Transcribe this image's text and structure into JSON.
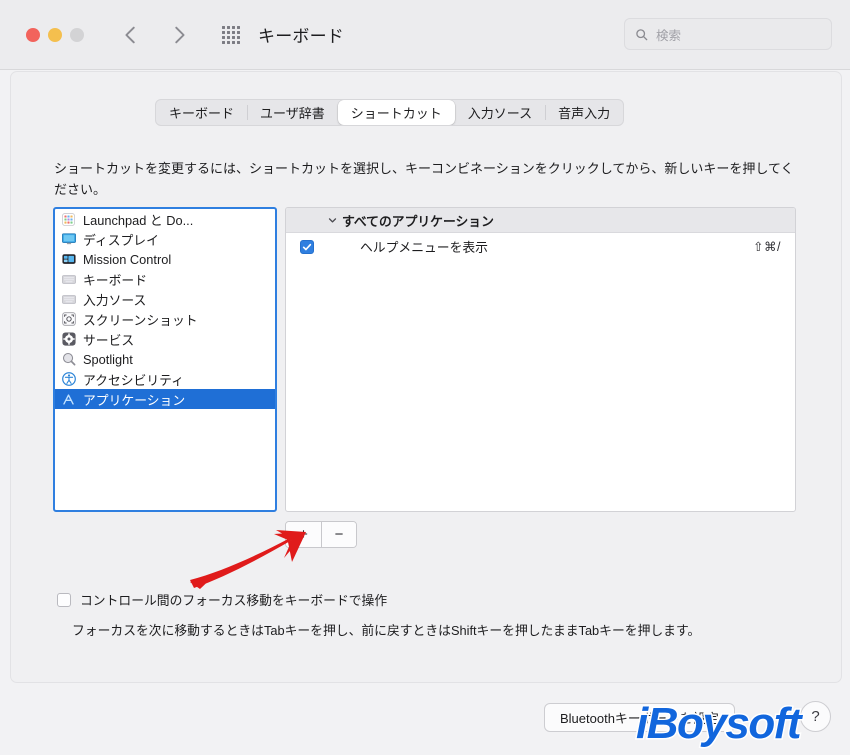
{
  "window": {
    "title": "キーボード",
    "traffic_lights": [
      "close",
      "minimize",
      "zoom"
    ],
    "back_label": "戻る",
    "forward_label": "進む",
    "grid_label": "すべてを表示"
  },
  "search": {
    "placeholder": "検索",
    "value": "",
    "icon": "search-icon"
  },
  "tabs": [
    {
      "label": "キーボード",
      "active": false
    },
    {
      "label": "ユーザ辞書",
      "active": false
    },
    {
      "label": "ショートカット",
      "active": true
    },
    {
      "label": "入力ソース",
      "active": false
    },
    {
      "label": "音声入力",
      "active": false
    }
  ],
  "description": "ショートカットを変更するには、ショートカットを選択し、キーコンビネーションをクリックしてから、新しいキーを押してください。",
  "sidebar": {
    "items": [
      {
        "label": "Launchpad と Do...",
        "icon": "launchpad-icon",
        "selected": false
      },
      {
        "label": "ディスプレイ",
        "icon": "display-icon",
        "selected": false
      },
      {
        "label": "Mission Control",
        "icon": "mission-control-icon",
        "selected": false
      },
      {
        "label": "キーボード",
        "icon": "keyboard-icon",
        "selected": false
      },
      {
        "label": "入力ソース",
        "icon": "input-source-icon",
        "selected": false
      },
      {
        "label": "スクリーンショット",
        "icon": "screenshot-icon",
        "selected": false
      },
      {
        "label": "サービス",
        "icon": "services-icon",
        "selected": false
      },
      {
        "label": "Spotlight",
        "icon": "spotlight-icon",
        "selected": false
      },
      {
        "label": "アクセシビリティ",
        "icon": "accessibility-icon",
        "selected": false
      },
      {
        "label": "アプリケーション",
        "icon": "applications-icon",
        "selected": true
      }
    ]
  },
  "shortcut_list": {
    "group_header": "すべてのアプリケーション",
    "disclosure_icon": "chevron-down-icon",
    "rows": [
      {
        "checked": true,
        "name": "ヘルプメニューを表示",
        "keys": "⇧⌘/"
      }
    ]
  },
  "list_buttons": {
    "add_label": "+",
    "remove_label": "−"
  },
  "annotation": {
    "arrow_color": "#e01b1b",
    "points_to": "add-shortcut-button"
  },
  "focus_option": {
    "checked": false,
    "label": "コントロール間のフォーカス移動をキーボードで操作",
    "note": "フォーカスを次に移動するときはTabキーを押し、前に戻すときはShiftキーを押したままTabキーを押します。"
  },
  "bottom_bar": {
    "bluetooth_button": "Bluetoothキーボードを設定",
    "help_button": "?"
  },
  "watermark": {
    "text": "iBoysoft",
    "color": "#1166dd"
  },
  "colors": {
    "accent": "#1f6fd6",
    "selection_border": "#2f7fe0",
    "checkbox": "#2f7fe0",
    "titlebar": "#ececee",
    "panel": "#f0f0f2",
    "arrow_red": "#e01b1b"
  }
}
